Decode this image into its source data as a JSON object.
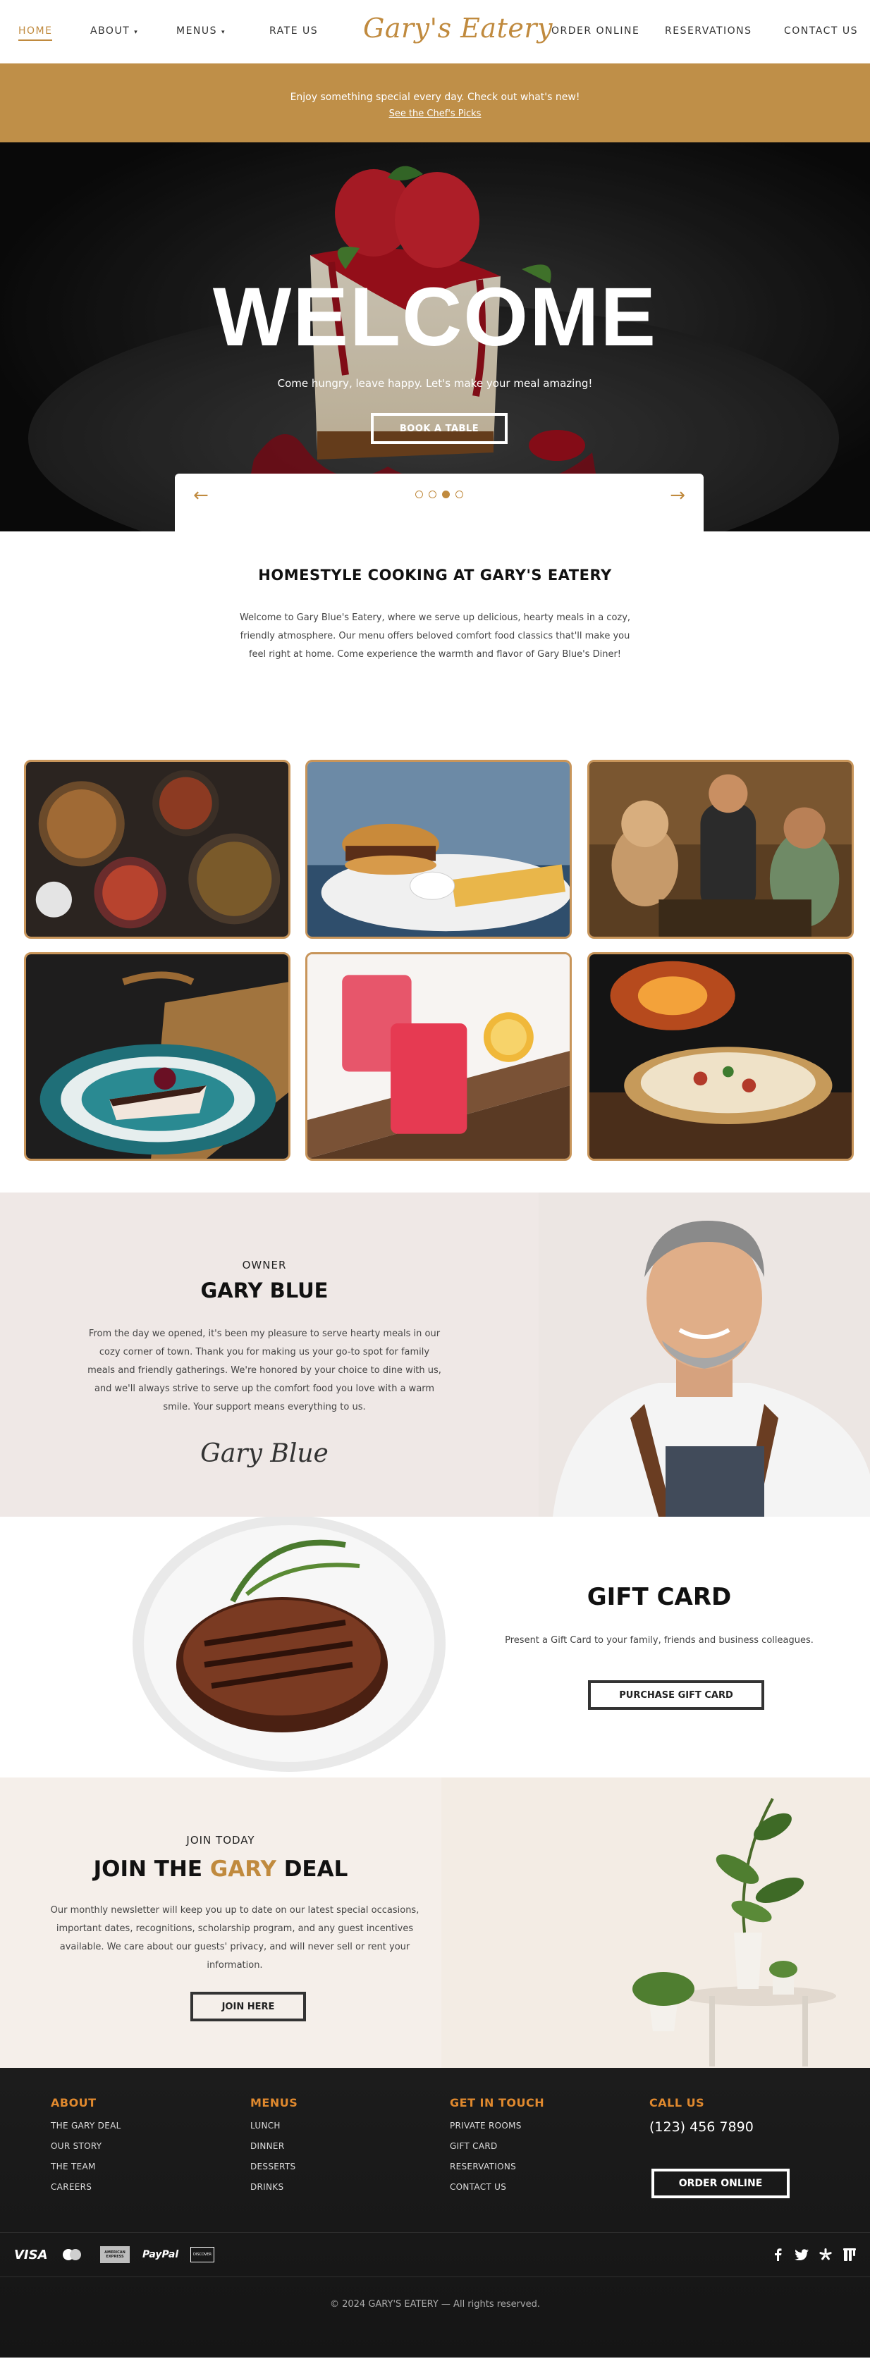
{
  "nav": {
    "home": "HOME",
    "about": "ABOUT",
    "menus": "MENUS",
    "rate_us": "RATE US",
    "logo": "Gary's Eatery",
    "order_online": "ORDER ONLINE",
    "reservations": "RESERVATIONS",
    "contact_us": "CONTACT US",
    "caret": "▾"
  },
  "announcement": {
    "text": "Enjoy something special every day. Check out what's new!",
    "link": "See the Chef's Picks"
  },
  "hero": {
    "title": "WELCOME",
    "subtitle": "Come hungry, leave happy. Let's make your meal amazing!",
    "button": "BOOK A TABLE",
    "prev": "←",
    "next": "→",
    "active_slide": 3,
    "slide_count": 4
  },
  "intro": {
    "title": "HOMESTYLE COOKING AT GARY'S EATERY",
    "body": "Welcome to Gary Blue's Eatery, where we serve up delicious, hearty meals in a cozy, friendly atmosphere. Our menu offers beloved comfort food classics that'll make you feel right at home. Come experience the warmth and flavor of Gary Blue's Diner!"
  },
  "owner": {
    "label": "OWNER",
    "name": "GARY BLUE",
    "bio": "From the day we opened, it's been my pleasure to serve hearty meals in our cozy corner of town. Thank you for making us your go-to spot for family meals and friendly gatherings. We're honored by your choice to dine with us, and we'll always strive to serve up the comfort food you love with a warm smile. Your support means everything to us.",
    "signature": "Gary Blue"
  },
  "gift": {
    "title": "GIFT CARD",
    "description": "Present a Gift Card to your family, friends and business colleagues.",
    "button": "PURCHASE GIFT CARD"
  },
  "newsletter": {
    "eyebrow": "JOIN TODAY",
    "title_pre": "JOIN THE ",
    "title_accent": "GARY",
    "title_post": " DEAL",
    "body": "Our monthly newsletter will keep you up to date on our latest special occasions, important dates, recognitions, scholarship program, and any guest incentives available. We care about our guests' privacy, and will never sell or rent your information.",
    "button": "JOIN HERE"
  },
  "footer": {
    "about": {
      "heading": "ABOUT",
      "links": [
        "THE GARY DEAL",
        "OUR STORY",
        "THE TEAM",
        "CAREERS"
      ]
    },
    "menus": {
      "heading": "MENUS",
      "links": [
        "LUNCH",
        "DINNER",
        "DESSERTS",
        "DRINKS"
      ]
    },
    "contact": {
      "heading": "GET IN TOUCH",
      "links": [
        "PRIVATE ROOMS",
        "GIFT CARD",
        "RESERVATIONS",
        "CONTACT US"
      ]
    },
    "call": {
      "heading": "CALL US",
      "phone": "(123) 456 7890",
      "button": "ORDER ONLINE"
    },
    "payments": {
      "visa": "VISA",
      "paypal": "PayPal",
      "discover": "DISCOVER",
      "amex": "AMERICAN EXPRESS"
    },
    "social_icons": [
      "facebook-icon",
      "twitter-icon",
      "yelp-icon",
      "tripadvisor-icon"
    ],
    "copyright": "© 2024 GARY'S EATERY — All rights reserved."
  },
  "colors": {
    "accent": "#c08a3e",
    "announcement_bg": "#bf8f48",
    "footer_heading": "#e0892e",
    "owner_bg": "#efe8e6",
    "newsletter_bg": "#f5efea",
    "footer_bg": "#1a1a1a"
  }
}
